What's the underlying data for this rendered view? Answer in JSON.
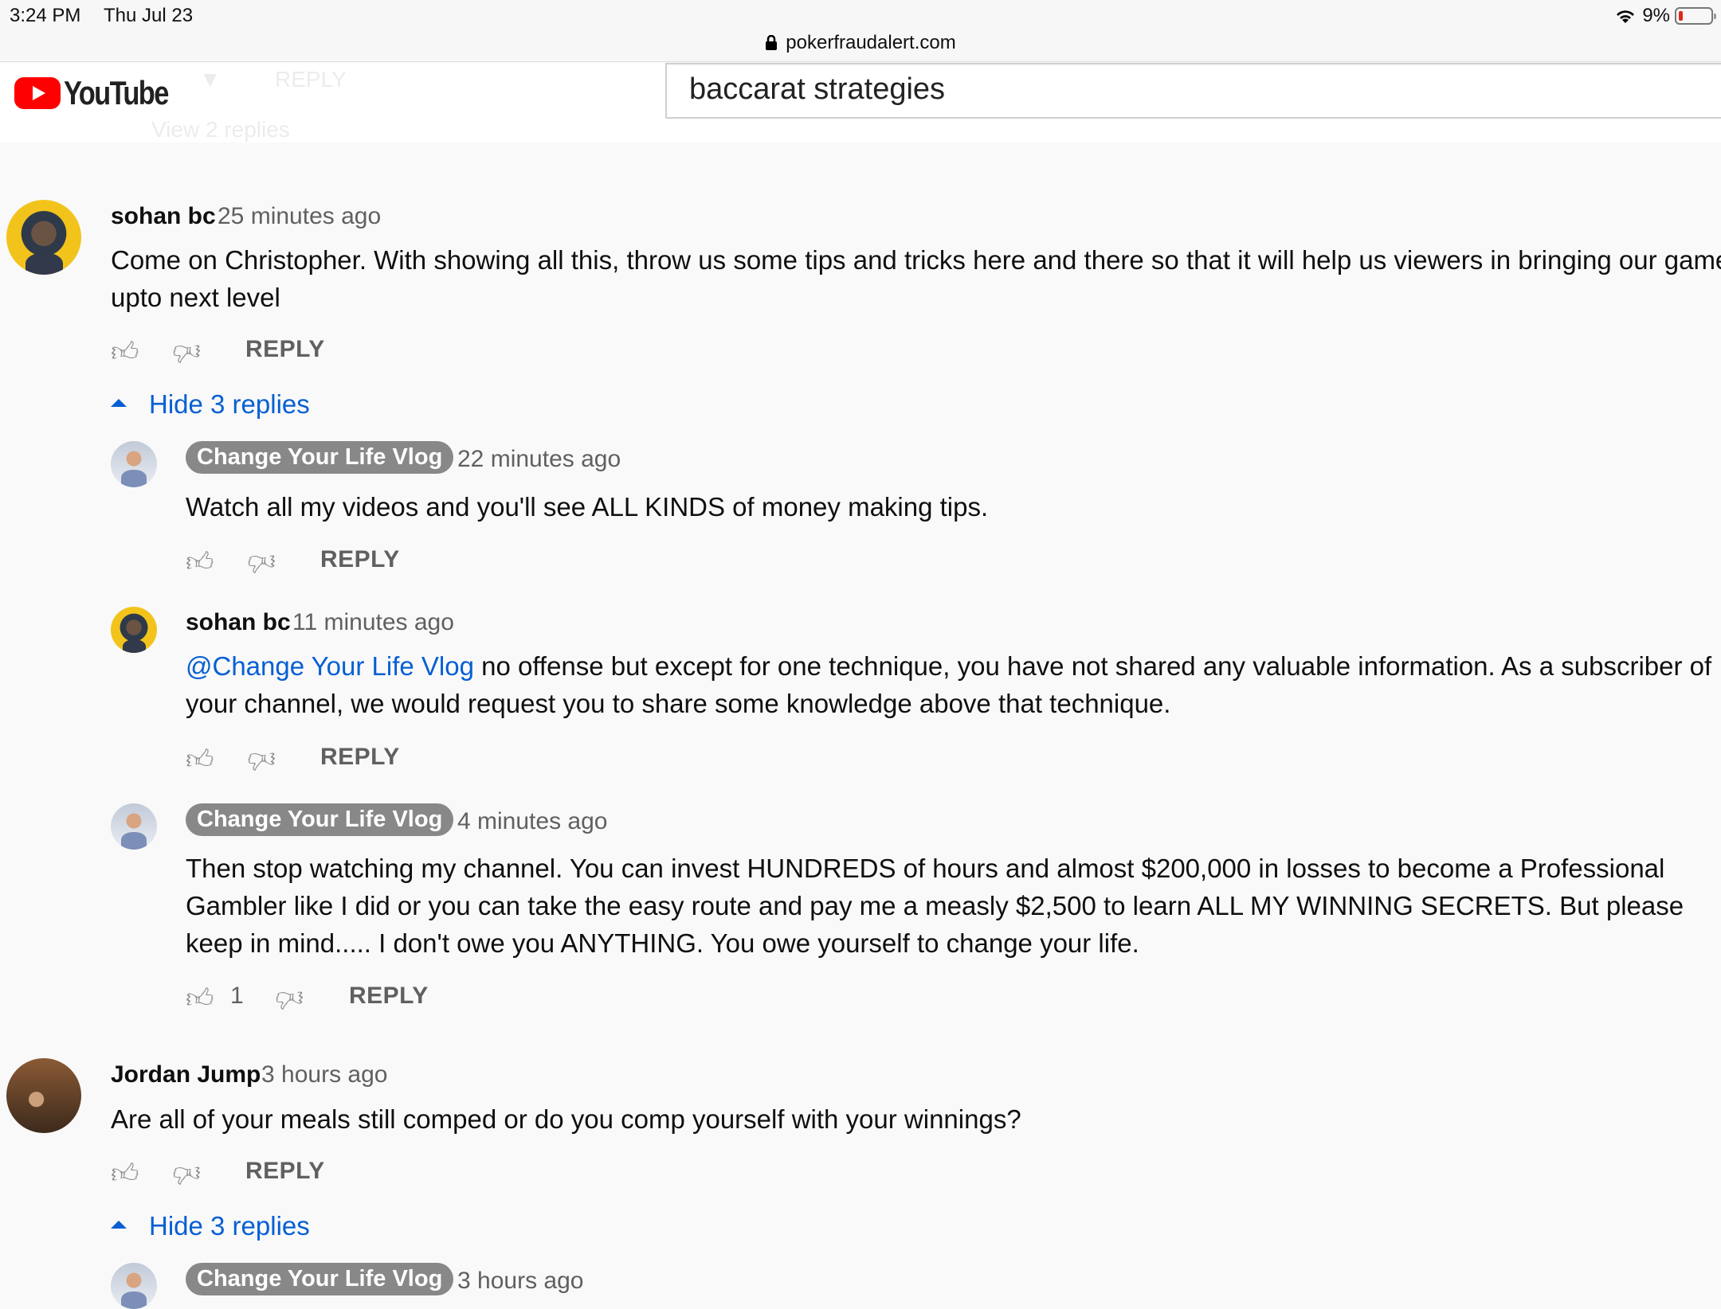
{
  "status": {
    "time": "3:24 PM",
    "date": "Thu Jul 23",
    "battery": "9%"
  },
  "browser": {
    "url": "pokerfraudalert.com"
  },
  "youtube": {
    "logo": "YouTube",
    "search_value": "baccarat strategies",
    "ghost_reply": "REPLY",
    "ghost_view": "View 2 replies"
  },
  "comments": [
    {
      "author": "sohan bc",
      "time": "25 minutes ago",
      "text": "Come on Christopher. With showing all this, throw us some tips and tricks here and there so that it will help us viewers in bringing our game upto next level",
      "reply": "REPLY",
      "hide_replies": "Hide 3 replies",
      "replies": [
        {
          "author": "Change Your Life Vlog",
          "time": "22 minutes ago",
          "text": "Watch all my videos and you'll see ALL KINDS of money making tips.",
          "reply": "REPLY"
        },
        {
          "author": "sohan bc",
          "time": "11 minutes ago",
          "mention": "@Change Your Life Vlog",
          "text": " no offense but except for one technique, you have not shared any valuable information. As a subscriber of your channel, we would request you to share some knowledge above that technique.",
          "reply": "REPLY"
        },
        {
          "author": "Change Your Life Vlog",
          "time": "4 minutes ago",
          "text": "Then stop watching my channel. You can invest HUNDREDS of hours and almost $200,000 in losses to become a Professional Gambler like I did or you can take the easy route and pay me a measly $2,500 to learn ALL MY WINNING SECRETS. But please keep in mind..... I don't owe you ANYTHING. You owe yourself to change your life.",
          "likes": "1",
          "reply": "REPLY"
        }
      ]
    },
    {
      "author": "Jordan Jump",
      "time": "3 hours ago",
      "text": "Are all of your meals still comped or do you comp yourself with your winnings?",
      "reply": "REPLY",
      "hide_replies": "Hide 3 replies",
      "replies": [
        {
          "author": "Change Your Life Vlog",
          "time": "3 hours ago"
        }
      ]
    }
  ]
}
